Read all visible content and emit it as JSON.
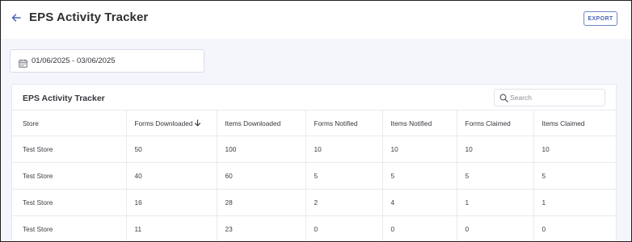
{
  "header": {
    "title": "EPS Activity Tracker",
    "export_label": "EXPORT"
  },
  "filters": {
    "date_range": "01/06/2025 - 03/06/2025"
  },
  "card": {
    "title": "EPS Activity Tracker",
    "search_placeholder": "Search"
  },
  "table": {
    "columns": [
      "Store",
      "Forms Downloaded",
      "Items Downloaded",
      "Forms Notified",
      "Items Notified",
      "Forms Claimed",
      "Items Claimed"
    ],
    "sorted_column": "Forms Downloaded",
    "sort_direction": "descending",
    "rows": [
      [
        "Test Store",
        "50",
        "100",
        "10",
        "10",
        "10",
        "10"
      ],
      [
        "Test Store",
        "40",
        "60",
        "5",
        "5",
        "5",
        "5"
      ],
      [
        "Test Store",
        "16",
        "28",
        "2",
        "4",
        "1",
        "1"
      ],
      [
        "Test Store",
        "11",
        "23",
        "0",
        "0",
        "0",
        "0"
      ]
    ]
  },
  "colors": {
    "accent": "#4a64b6",
    "background": "#f4f6fb"
  }
}
